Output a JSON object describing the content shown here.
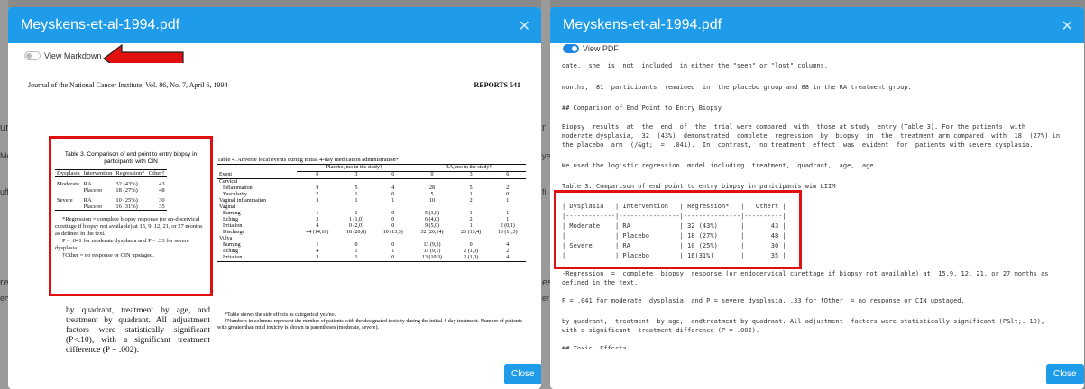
{
  "background": {
    "left_fragments": [
      "ur",
      "Mey",
      "uffi",
      "res",
      "erv"
    ],
    "right_fragments": [
      "r",
      "ye",
      "fi",
      "es",
      "er"
    ]
  },
  "left_modal": {
    "title": "Meyskens-et-al-1994.pdf",
    "toggle_label": "View Markdown",
    "toggle_on": false,
    "close_label": "Close",
    "pdf": {
      "journal_line": "Journal of the National Cancer Institute, Vol. 86, No. 7, April 6, 1994",
      "reports": "REPORTS   541",
      "table3": {
        "title": "Table 3. Comparison of end point to entry biopsy in participants with CIN",
        "headers": [
          "Dysplasia",
          "Intervention",
          "Regression*",
          "Other†"
        ],
        "rows": [
          [
            "Moderate",
            "RA",
            "32 (43%)",
            "43"
          ],
          [
            "",
            "Placebo",
            "18 (27%)",
            "48"
          ],
          [
            "Severe",
            "RA",
            "10 (25%)",
            "30"
          ],
          [
            "",
            "Placebo",
            "16 (31%)",
            "35"
          ]
        ],
        "footnotes": [
          "*Regression = complete biopsy response (or en-docervical curettage if biopsy not available) at 15, 9, 12, 21, or 27 months as defined in the text.",
          "P = .041 for moderate dysplasia and P = .33 for severe dysplasia.",
          "†Other = no response or CIN upstaged."
        ]
      },
      "table4": {
        "title": "Table 4. Adverse local events during initial 4-day medication administration*",
        "group_placebo": "Placebo, mo in the study†",
        "group_ra": "RA, mo in the study†",
        "event_label": "Event",
        "months": [
          "0",
          "3",
          "6",
          "0",
          "3",
          "6"
        ],
        "sections": [
          {
            "name": "Cervical",
            "rows": [
              [
                "Inflammation",
                "9",
                "5",
                "4",
                "28",
                "5",
                "2"
              ],
              [
                "Vascularity",
                "2",
                "1",
                "0",
                "5",
                "1",
                "0"
              ]
            ]
          },
          {
            "name": "Vaginal inflammation",
            "inline": [
              "3",
              "1",
              "1",
              "10",
              "2",
              "1"
            ],
            "rows": []
          },
          {
            "name": "Vaginal",
            "rows": [
              [
                "Burning",
                "1",
                "1",
                "0",
                "5 (3,0)",
                "1",
                "1"
              ],
              [
                "Itching",
                "3",
                "1 (1,0)",
                "0",
                "6 (4,0)",
                "2",
                "1"
              ],
              [
                "Irritation",
                "4",
                "0 (2,0)",
                "0",
                "9 (5,0)",
                "1",
                "2 (0,1)"
              ],
              [
                "Discharge",
                "44 (14,10)",
                "18 (20,8)",
                "10 (13,5)",
                "32 (26,14)",
                "26 (13,4)",
                "13 (11,3)"
              ]
            ]
          },
          {
            "name": "Vulva",
            "rows": [
              [
                "Burning",
                "1",
                "0",
                "0",
                "13 (9,3)",
                "0",
                "4"
              ],
              [
                "Itching",
                "4",
                "1",
                "1",
                "11 (9,1)",
                "2 (1,0)",
                "2"
              ],
              [
                "Irritation",
                "3",
                "1",
                "0",
                "13 (10,3)",
                "2 (1,0)",
                "4"
              ]
            ]
          }
        ],
        "footnotes": [
          "*Table shows the side effects as categorical yes/no.",
          "†Numbers in columns represent the number of patients with the designated toxicity during the initial 4-day treatment. Number of patients with greater than mild toxicity is shown in parentheses (moderate, severe)."
        ]
      },
      "body_text": "by quadrant, treatment by age, and treatment by quadrant. All adjustment factors were statistically significant (P<.10), with a significant treatment difference (P = .002)."
    }
  },
  "right_modal": {
    "title": "Meyskens-et-al-1994.pdf",
    "toggle_label": "View PDF",
    "toggle_on": true,
    "close_label": "Close",
    "markdown": {
      "line1": "date,  she  is  not  included  in either the \"seen\" or \"lost\" columns.",
      "line2": "months,  81  participants  remained  in  the placebo group and 88 in the RA treatment group.",
      "line3": "## Comparison of End Point to Entry Biopsy",
      "para1": "Biopsy  results  at  the  end  of  the  trial were compared  with  those at study  entry (Table 3). For the patients  with\nmoderate dysplasia,  32  (43%)  demonstrated  complete  regression  by  biopsy  in  the  treatment arm compared  with  18  (27%) in\nthe placebo  arm  (/&gt;  =  .041).  In  contrast,  no treatment  effect  was  evident  for  patients with severe dysplasia.",
      "line4": "We used the logistic regression  model including  treatment,  quadrant,  age,  age",
      "line5": "Table 3. Comparison of end point to entry biopsy in panicipanis wim LIIM",
      "table": "| Dysplasia   | Intervention   | Regression*   |   Othert |\n|-------------|----------------|---------------|----------|\n| Moderate    | RA             | 32 (43%)      |       43 |\n|             | Placebo        | 18 (27%)      |       48 |\n| Severe      | RA             | 10 (25%)      |       30 |\n|             | Placebo        | 16(31%)       |       35 |",
      "para2": "-Regression  =  complete  biopsy  response (or endocervical curettage if biopsy not available) at  15,9, 12, 21, or 27 months as\ndefined in the text.",
      "line6": "P = .041 for moderate  dysplasia  and P = severe dysplasia. .33 for fOther  = no response or CIN upstaged.",
      "para3": "by quadrant,  treatment  by age,  andtreatment by quadrant. All adjustment  factors were statistically significant (P&lt;. 10),\nwith a significant  treatment difference (P = .002).",
      "line7": "## Toxic  Effects"
    }
  },
  "colors": {
    "header_blue": "#1e9be9",
    "highlight_red": "#e01010",
    "toggle_blue": "#1e88e5"
  }
}
